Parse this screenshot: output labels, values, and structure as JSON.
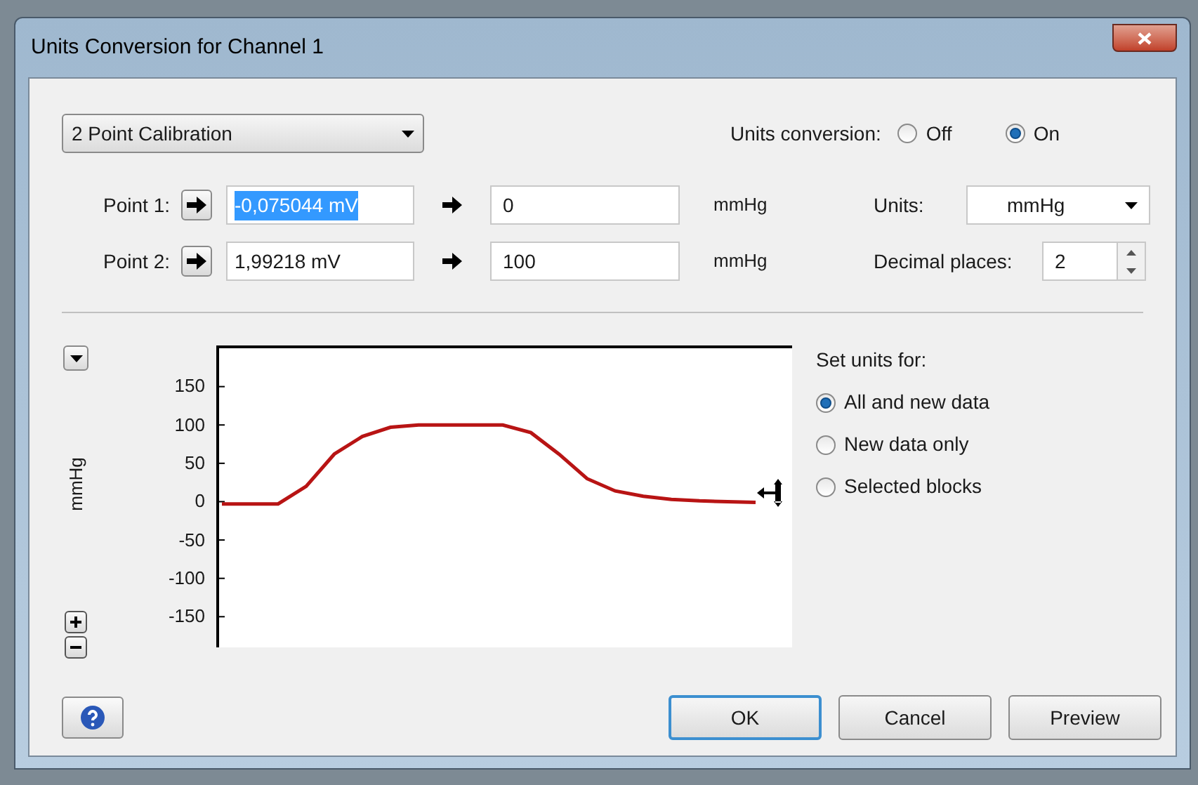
{
  "window": {
    "title": "Units Conversion for Channel 1"
  },
  "mode_dropdown": {
    "value": "2 Point Calibration"
  },
  "units_conversion": {
    "label": "Units conversion:",
    "options": [
      {
        "label": "Off",
        "selected": false
      },
      {
        "label": "On",
        "selected": true
      }
    ]
  },
  "points": [
    {
      "label": "Point 1:",
      "input": "-0,075044 mV",
      "input_selected": true,
      "output": "0",
      "unit": "mmHg"
    },
    {
      "label": "Point 2:",
      "input": "1,99218 mV",
      "input_selected": false,
      "output": "100",
      "unit": "mmHg"
    }
  ],
  "units": {
    "label": "Units:",
    "value": "mmHg"
  },
  "decimal_places": {
    "label": "Decimal places:",
    "value": "2"
  },
  "plot": {
    "chart_data": {
      "type": "line",
      "ylabel": "mmHg",
      "ylim": [
        -190,
        200
      ],
      "yticks": [
        150,
        100,
        50,
        0,
        -50,
        -100,
        -150
      ],
      "series": [
        {
          "color": "#b81414",
          "values": [
            -3,
            -3,
            -3,
            20,
            62,
            85,
            97,
            100,
            100,
            100,
            100,
            90,
            62,
            30,
            14,
            7,
            3,
            1,
            0,
            -1
          ]
        }
      ]
    }
  },
  "set_units_for": {
    "label": "Set units for:",
    "options": [
      {
        "label": "All and new data",
        "selected": true
      },
      {
        "label": "New data only",
        "selected": false
      },
      {
        "label": "Selected blocks",
        "selected": false
      }
    ]
  },
  "buttons": [
    {
      "label": "OK",
      "default": true
    },
    {
      "label": "Cancel",
      "default": false
    },
    {
      "label": "Preview",
      "default": false
    }
  ]
}
